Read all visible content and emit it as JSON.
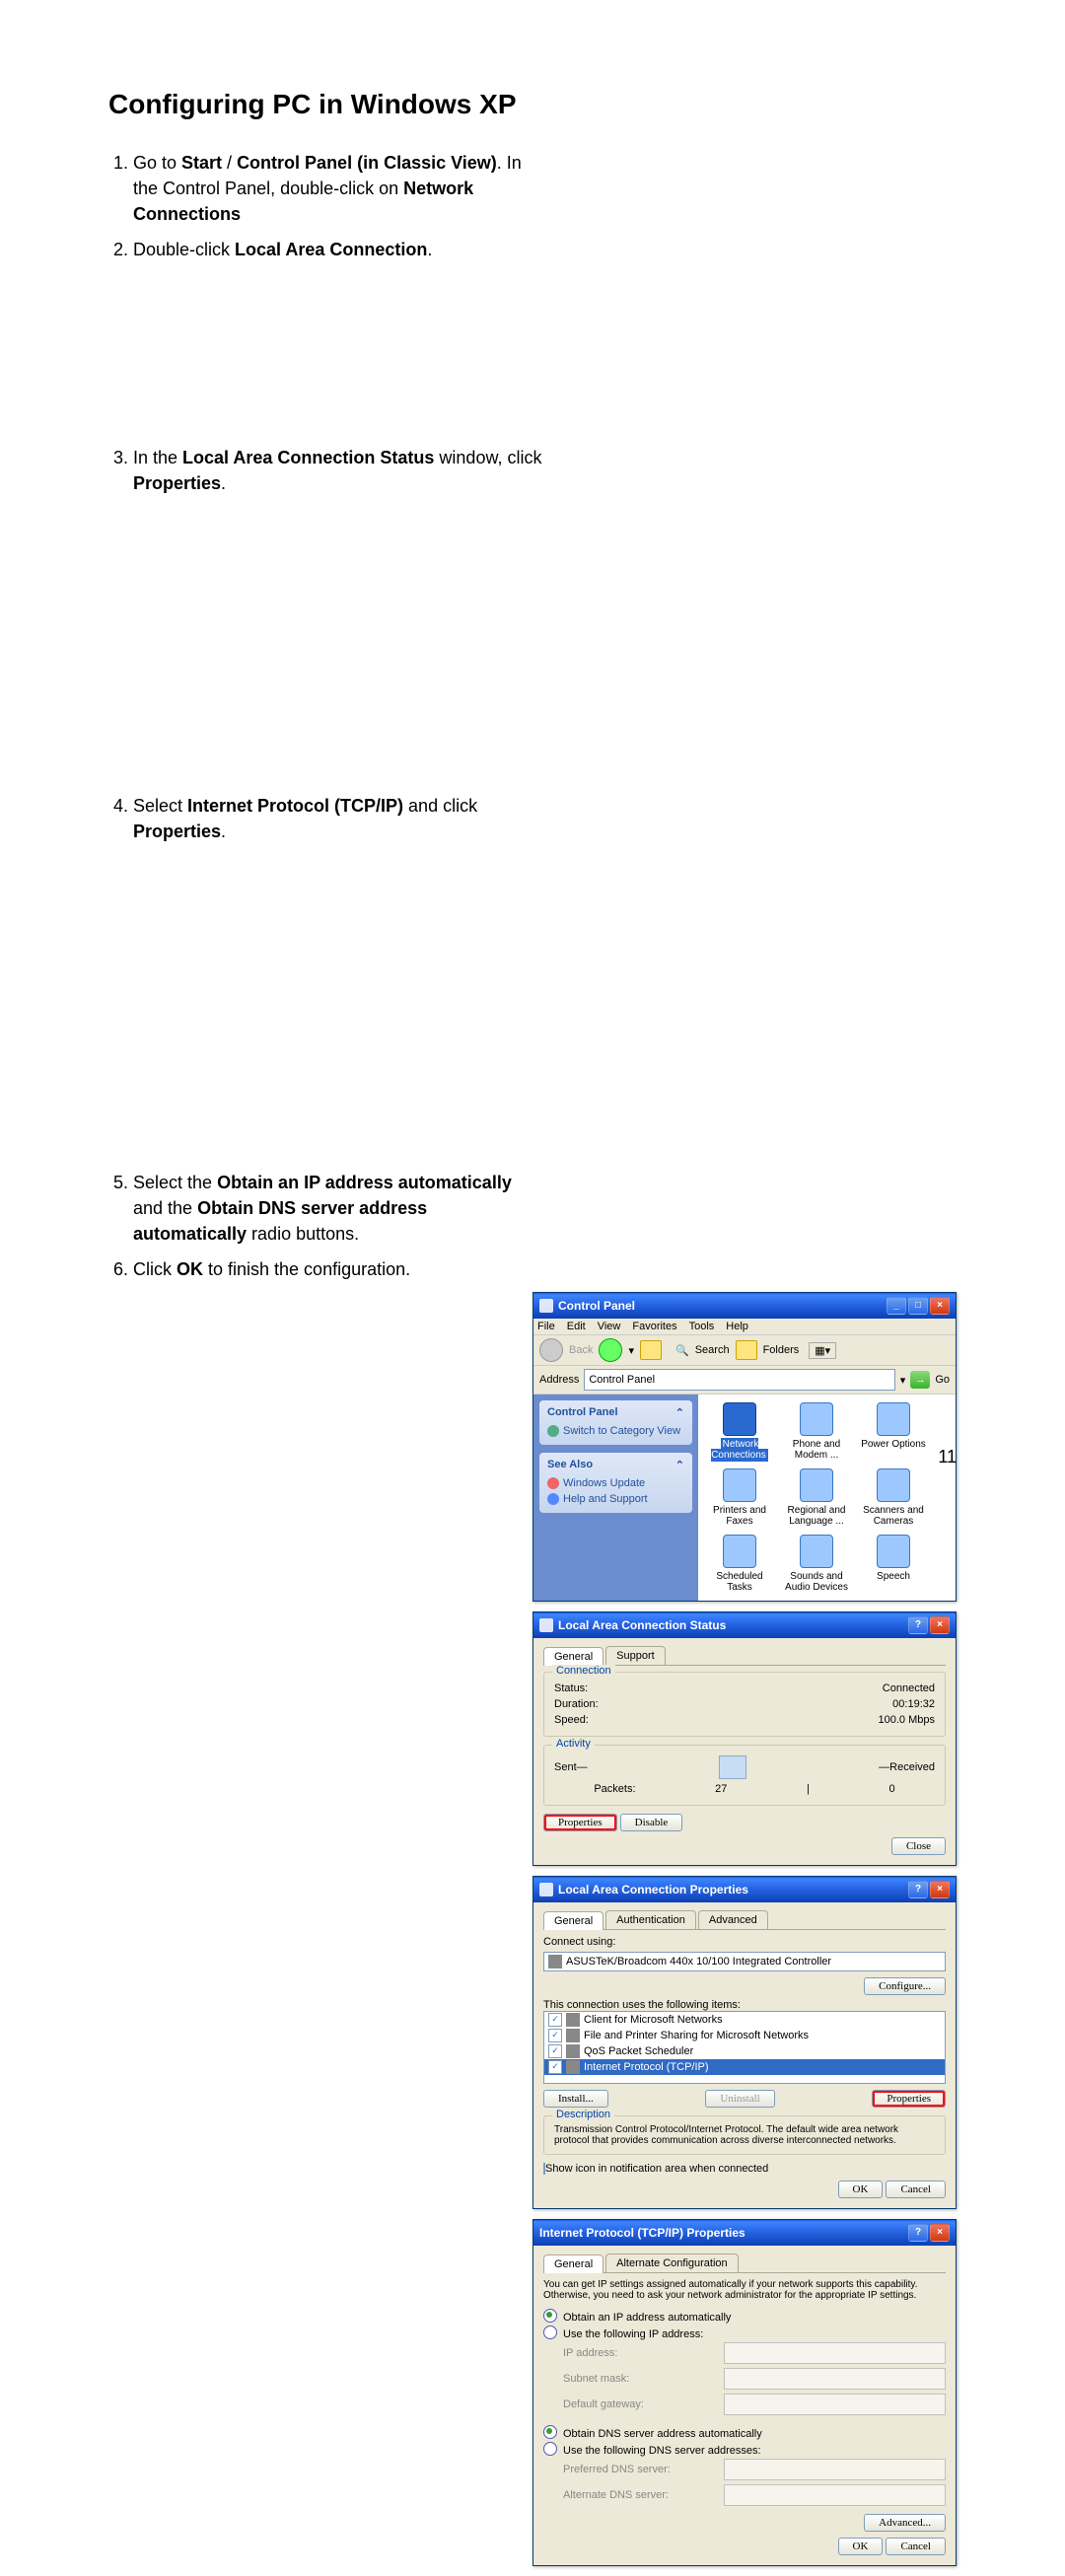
{
  "page_title": "Configuring PC in Windows XP",
  "steps": [
    {
      "pre": "Go to ",
      "b1": "Start",
      "mid": " / ",
      "b2": "Control Panel (in Classic View)",
      "aft": ". In the Control Panel, double-click on ",
      "b3": "Network Connections",
      "suf": ""
    },
    {
      "pre": "Double-click ",
      "b1": "Local Area Connection",
      "aft": "."
    },
    {
      "pre": "In the ",
      "b1": "Local Area Connection Status",
      "aft": " window, click ",
      "b2": "Properties",
      "suf": "."
    },
    {
      "pre": "Select ",
      "b1": "Internet Protocol (TCP/IP)",
      "aft": " and click ",
      "b2": "Properties",
      "suf": "."
    },
    {
      "pre": "Select the ",
      "b1": "Obtain an IP address automatically",
      "aft": " and the ",
      "b2": "Obtain DNS server address automatically",
      "suf": " radio buttons."
    },
    {
      "pre": "Click ",
      "b1": "OK",
      "aft": " to finish the configuration."
    }
  ],
  "cp_window": {
    "title": "Control Panel",
    "menus": [
      "File",
      "Edit",
      "View",
      "Favorites",
      "Tools",
      "Help"
    ],
    "toolbar": {
      "back": "Back",
      "search": "Search",
      "folders": "Folders"
    },
    "address_label": "Address",
    "address_value": "Control Panel",
    "go": "Go",
    "sidepane": {
      "box1": {
        "title": "Control Panel",
        "item": "Switch to Category View"
      },
      "box2": {
        "title": "See Also",
        "items": [
          "Windows Update",
          "Help and Support"
        ]
      }
    },
    "icons": [
      "Network Connections",
      "Phone and Modem ...",
      "Power Options",
      "Printers and Faxes",
      "Regional and Language ...",
      "Scanners and Cameras",
      "Scheduled Tasks",
      "Sounds and Audio Devices",
      "Speech"
    ]
  },
  "status_dialog": {
    "title": "Local Area Connection Status",
    "tabs": [
      "General",
      "Support"
    ],
    "conn_label": "Connection",
    "rows": [
      [
        "Status:",
        "Connected"
      ],
      [
        "Duration:",
        "00:19:32"
      ],
      [
        "Speed:",
        "100.0 Mbps"
      ]
    ],
    "act_label": "Activity",
    "sent": "Sent",
    "received": "Received",
    "packets_label": "Packets:",
    "packets_sent": "27",
    "packets_recv": "0",
    "properties": "Properties",
    "disable": "Disable",
    "close": "Close"
  },
  "props_dialog": {
    "title": "Local Area Connection Properties",
    "tabs": [
      "General",
      "Authentication",
      "Advanced"
    ],
    "connect_using": "Connect using:",
    "adapter": "ASUSTeK/Broadcom 440x 10/100 Integrated Controller",
    "configure": "Configure...",
    "items_label": "This connection uses the following items:",
    "items": [
      "Client for Microsoft Networks",
      "File and Printer Sharing for Microsoft Networks",
      "QoS Packet Scheduler",
      "Internet Protocol (TCP/IP)"
    ],
    "install": "Install...",
    "uninstall": "Uninstall",
    "properties": "Properties",
    "desc_label": "Description",
    "desc_text": "Transmission Control Protocol/Internet Protocol. The default wide area network protocol that provides communication across diverse interconnected networks.",
    "show_icon": "Show icon in notification area when connected",
    "ok": "OK",
    "cancel": "Cancel"
  },
  "tcpip_dialog": {
    "title": "Internet Protocol (TCP/IP) Properties",
    "tabs": [
      "General",
      "Alternate Configuration"
    ],
    "blurb": "You can get IP settings assigned automatically if your network supports this capability. Otherwise, you need to ask your network administrator for the appropriate IP settings.",
    "r1": "Obtain an IP address automatically",
    "r2": "Use the following IP address:",
    "ip": "IP address:",
    "mask": "Subnet mask:",
    "gw": "Default gateway:",
    "r3": "Obtain DNS server address automatically",
    "r4": "Use the following DNS server addresses:",
    "pdns": "Preferred DNS server:",
    "adns": "Alternate DNS server:",
    "advanced": "Advanced...",
    "ok": "OK",
    "cancel": "Cancel"
  },
  "pageno": "11"
}
